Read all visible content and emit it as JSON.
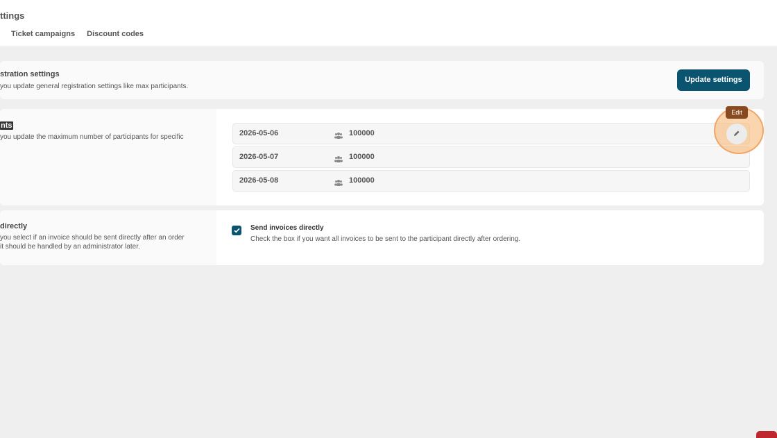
{
  "header": {
    "title": "ttings",
    "tabs": [
      {
        "label": "Ticket campaigns"
      },
      {
        "label": "Discount codes"
      }
    ]
  },
  "registration": {
    "title": "stration settings",
    "description": "you update general registration settings like max participants.",
    "button_label": "Update settings"
  },
  "participants": {
    "title": "nts",
    "description": "you update the maximum number of participants for specific",
    "rows": [
      {
        "date": "2026-05-06",
        "count": "100000"
      },
      {
        "date": "2026-05-07",
        "count": "100000"
      },
      {
        "date": "2026-05-08",
        "count": "100000"
      }
    ],
    "edit_tooltip": "Edit"
  },
  "invoices": {
    "title": "directly",
    "description_line1": "you select if an invoice should be sent directly after an order",
    "description_line2": "it should be handled by an administrator later.",
    "checkbox_label": "Send invoices directly",
    "checkbox_desc": "Check the box if you want all invoices to be sent to the participant directly after ordering.",
    "checked": true
  },
  "colors": {
    "primary": "#0a5470",
    "highlight": "#f6b26b",
    "tooltip": "#8a4a1f"
  }
}
